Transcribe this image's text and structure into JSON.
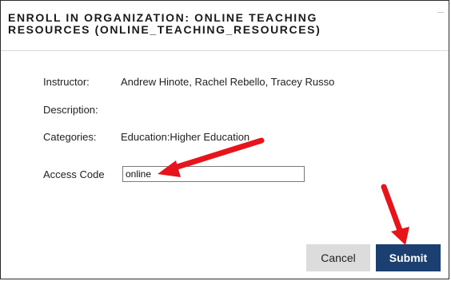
{
  "dialog": {
    "title_line1": "ENROLL IN ORGANIZATION: ONLINE TEACHING",
    "title_line2": "RESOURCES (ONLINE_TEACHING_RESOURCES)"
  },
  "fields": {
    "instructor": {
      "label": "Instructor:",
      "value": "Andrew Hinote, Rachel Rebello, Tracey Russo"
    },
    "description": {
      "label": "Description:",
      "value": ""
    },
    "categories": {
      "label": "Categories:",
      "value": "Education:Higher Education"
    },
    "access_code": {
      "label": "Access Code",
      "value": "online"
    }
  },
  "buttons": {
    "cancel": "Cancel",
    "submit": "Submit"
  },
  "colors": {
    "submit_background": "#1c3f72",
    "cancel_background": "#dcdcdc",
    "annotation_arrow": "#e8141b"
  },
  "annotations": {
    "arrow_icon_1": "red-arrow-icon",
    "arrow_icon_2": "red-arrow-icon"
  }
}
